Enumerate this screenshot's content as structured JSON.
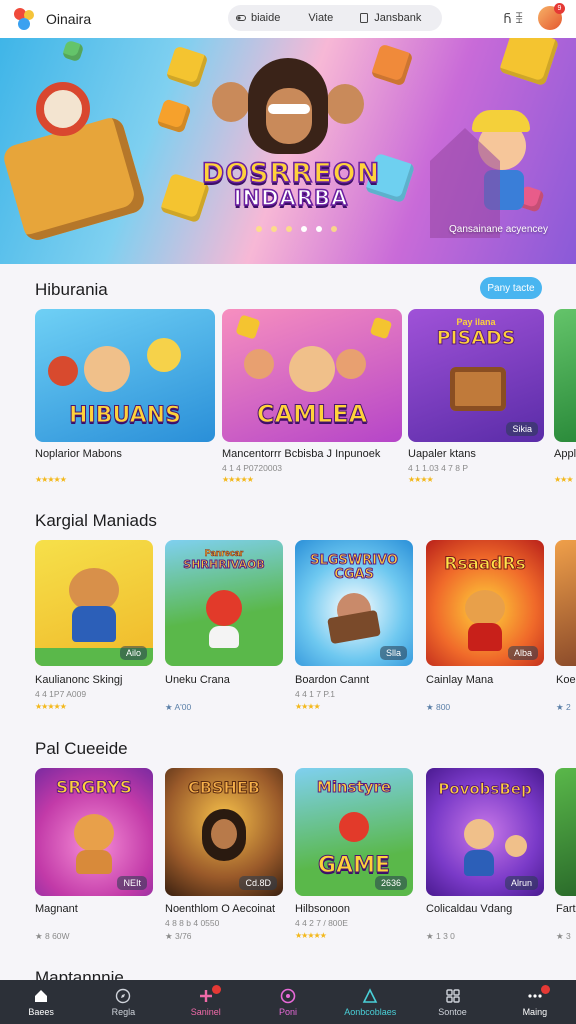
{
  "app": {
    "title": "Oinaira"
  },
  "search": {
    "seg1": "biaide",
    "seg2": "Viate",
    "seg3": "Jansbank"
  },
  "topbar": {
    "qr_label": "Ⴌ ꀨ",
    "notifications": "9"
  },
  "hero": {
    "title_line1": "DOSRREON",
    "title_line2": "INDARBA",
    "subtitle": "Qansainane acyencey",
    "dots": 6,
    "active_dot": 4
  },
  "sections": [
    {
      "title": "Hiburania",
      "action": "Pany tacte",
      "cards": [
        {
          "art": "HIBUANS",
          "name": "Noplarior Mabons",
          "meta": "",
          "stars": "★★★★★"
        },
        {
          "art": "CAMLEA",
          "name": "Mancentorrr Bcbisba J Inpunoek",
          "meta": "4 1 4 P0720003",
          "stars": "★★★★★"
        },
        {
          "art_top": "PISADS",
          "art_top_small": "Pay ilana",
          "tag": "Sikia",
          "name": "Uapaler ktans",
          "meta": "4 1 1.03 4 7 8 P",
          "stars": "★★★★"
        },
        {
          "name": "Appl",
          "meta": "",
          "stars": "★★★"
        }
      ]
    },
    {
      "title": "Kargial Maniads",
      "cards": [
        {
          "tag": "Ailo",
          "name": "Kaulianonc Skingj",
          "meta": "4 4 1P7 A009",
          "stars": "★★★★★"
        },
        {
          "art_top": "SHRHRIVAOB",
          "art_top_small": "Panrecar",
          "name": "Uneku Crana",
          "meta": "",
          "stars_text": "★ A'00"
        },
        {
          "art_top": "SLGSWRIVO CGAS",
          "tag": "Slla",
          "name": "Boardon Cannt",
          "meta": "4 4 1 7 P.1",
          "stars": "★★★★"
        },
        {
          "art_top": "RsaadRs",
          "tag": "Alba",
          "name": "Cainlay Mana",
          "meta": "",
          "stars_text": "★ 800"
        },
        {
          "name": "Koe",
          "meta": "",
          "stars_text": "★ 2"
        }
      ]
    },
    {
      "title": "Pal Cueeide",
      "cards": [
        {
          "art_top": "SRGRYS",
          "tag": "NEIt",
          "name": "Magnant",
          "meta": "",
          "stars_text": "★ 8 60W"
        },
        {
          "art_top": "CBSHEB",
          "tag": "Cd.8D",
          "name": "Noenthlom O Aecoinat",
          "meta": "4 8 8 b 4 0550",
          "stars_text": "★ 3/76"
        },
        {
          "art_top": "Minstyre",
          "art": "GAME",
          "tag": "2636",
          "name": "Hilbsonoon",
          "meta": "4 4 2 7 / 800E",
          "stars": "★★★★★"
        },
        {
          "art_top": "PovobsBep",
          "tag": "Alrun",
          "name": "Colicaldau Vdang",
          "meta": "",
          "stars_text": "★ 1 3 0"
        },
        {
          "name": "Fartu",
          "meta": "",
          "stars_text": "★ 3"
        }
      ]
    },
    {
      "title": "Maptannnie"
    }
  ],
  "nav": [
    {
      "label": "Baees",
      "icon": "home-icon"
    },
    {
      "label": "Regla",
      "icon": "compass-icon"
    },
    {
      "label": "Saninel",
      "icon": "plus-icon",
      "badge": true
    },
    {
      "label": "Poni",
      "icon": "circle-icon"
    },
    {
      "label": "Aonbcoblaes",
      "icon": "triangle-icon"
    },
    {
      "label": "Sontoe",
      "icon": "grid-icon"
    },
    {
      "label": "Maing",
      "icon": "more-icon",
      "badge": true
    }
  ],
  "colors": {
    "accent": "#49b5f0",
    "nav_bg": "#2c3038",
    "star": "#f3b81b",
    "hero_text": "#ffd23b"
  }
}
